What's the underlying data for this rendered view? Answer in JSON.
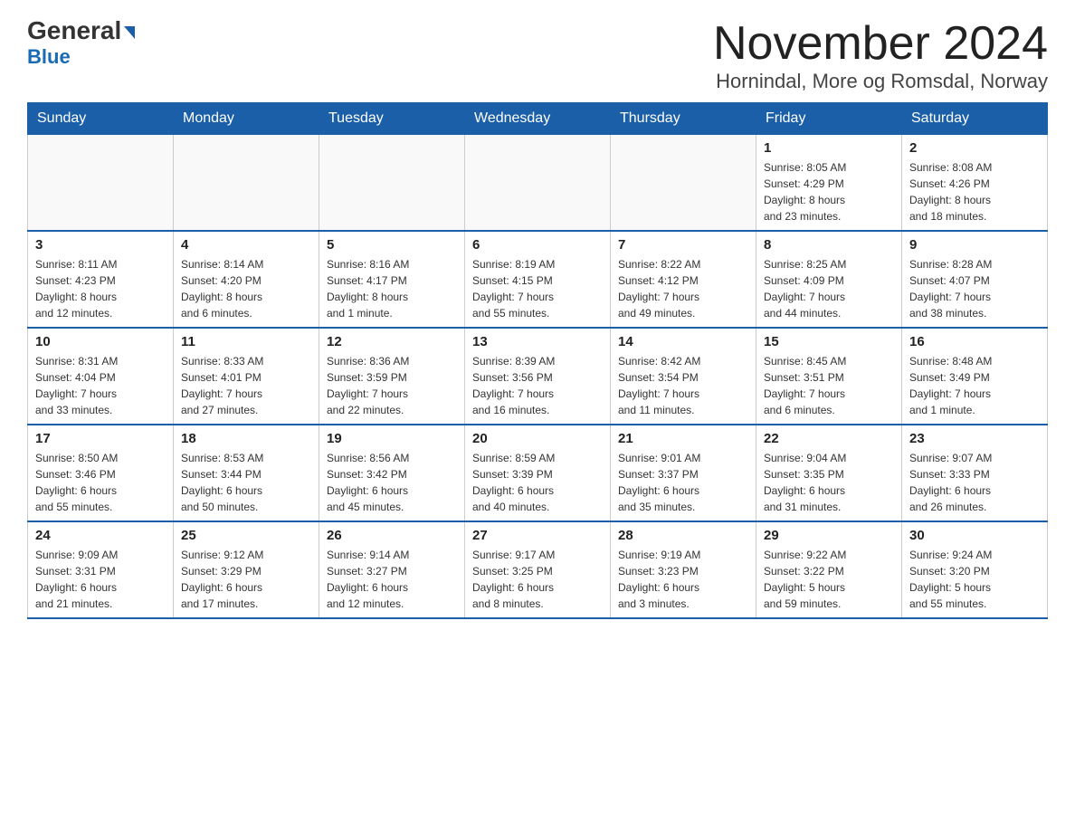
{
  "header": {
    "logo_general": "General",
    "logo_blue": "Blue",
    "title": "November 2024",
    "subtitle": "Hornindal, More og Romsdal, Norway"
  },
  "calendar": {
    "days_of_week": [
      "Sunday",
      "Monday",
      "Tuesday",
      "Wednesday",
      "Thursday",
      "Friday",
      "Saturday"
    ],
    "weeks": [
      [
        {
          "day": "",
          "info": ""
        },
        {
          "day": "",
          "info": ""
        },
        {
          "day": "",
          "info": ""
        },
        {
          "day": "",
          "info": ""
        },
        {
          "day": "",
          "info": ""
        },
        {
          "day": "1",
          "info": "Sunrise: 8:05 AM\nSunset: 4:29 PM\nDaylight: 8 hours\nand 23 minutes."
        },
        {
          "day": "2",
          "info": "Sunrise: 8:08 AM\nSunset: 4:26 PM\nDaylight: 8 hours\nand 18 minutes."
        }
      ],
      [
        {
          "day": "3",
          "info": "Sunrise: 8:11 AM\nSunset: 4:23 PM\nDaylight: 8 hours\nand 12 minutes."
        },
        {
          "day": "4",
          "info": "Sunrise: 8:14 AM\nSunset: 4:20 PM\nDaylight: 8 hours\nand 6 minutes."
        },
        {
          "day": "5",
          "info": "Sunrise: 8:16 AM\nSunset: 4:17 PM\nDaylight: 8 hours\nand 1 minute."
        },
        {
          "day": "6",
          "info": "Sunrise: 8:19 AM\nSunset: 4:15 PM\nDaylight: 7 hours\nand 55 minutes."
        },
        {
          "day": "7",
          "info": "Sunrise: 8:22 AM\nSunset: 4:12 PM\nDaylight: 7 hours\nand 49 minutes."
        },
        {
          "day": "8",
          "info": "Sunrise: 8:25 AM\nSunset: 4:09 PM\nDaylight: 7 hours\nand 44 minutes."
        },
        {
          "day": "9",
          "info": "Sunrise: 8:28 AM\nSunset: 4:07 PM\nDaylight: 7 hours\nand 38 minutes."
        }
      ],
      [
        {
          "day": "10",
          "info": "Sunrise: 8:31 AM\nSunset: 4:04 PM\nDaylight: 7 hours\nand 33 minutes."
        },
        {
          "day": "11",
          "info": "Sunrise: 8:33 AM\nSunset: 4:01 PM\nDaylight: 7 hours\nand 27 minutes."
        },
        {
          "day": "12",
          "info": "Sunrise: 8:36 AM\nSunset: 3:59 PM\nDaylight: 7 hours\nand 22 minutes."
        },
        {
          "day": "13",
          "info": "Sunrise: 8:39 AM\nSunset: 3:56 PM\nDaylight: 7 hours\nand 16 minutes."
        },
        {
          "day": "14",
          "info": "Sunrise: 8:42 AM\nSunset: 3:54 PM\nDaylight: 7 hours\nand 11 minutes."
        },
        {
          "day": "15",
          "info": "Sunrise: 8:45 AM\nSunset: 3:51 PM\nDaylight: 7 hours\nand 6 minutes."
        },
        {
          "day": "16",
          "info": "Sunrise: 8:48 AM\nSunset: 3:49 PM\nDaylight: 7 hours\nand 1 minute."
        }
      ],
      [
        {
          "day": "17",
          "info": "Sunrise: 8:50 AM\nSunset: 3:46 PM\nDaylight: 6 hours\nand 55 minutes."
        },
        {
          "day": "18",
          "info": "Sunrise: 8:53 AM\nSunset: 3:44 PM\nDaylight: 6 hours\nand 50 minutes."
        },
        {
          "day": "19",
          "info": "Sunrise: 8:56 AM\nSunset: 3:42 PM\nDaylight: 6 hours\nand 45 minutes."
        },
        {
          "day": "20",
          "info": "Sunrise: 8:59 AM\nSunset: 3:39 PM\nDaylight: 6 hours\nand 40 minutes."
        },
        {
          "day": "21",
          "info": "Sunrise: 9:01 AM\nSunset: 3:37 PM\nDaylight: 6 hours\nand 35 minutes."
        },
        {
          "day": "22",
          "info": "Sunrise: 9:04 AM\nSunset: 3:35 PM\nDaylight: 6 hours\nand 31 minutes."
        },
        {
          "day": "23",
          "info": "Sunrise: 9:07 AM\nSunset: 3:33 PM\nDaylight: 6 hours\nand 26 minutes."
        }
      ],
      [
        {
          "day": "24",
          "info": "Sunrise: 9:09 AM\nSunset: 3:31 PM\nDaylight: 6 hours\nand 21 minutes."
        },
        {
          "day": "25",
          "info": "Sunrise: 9:12 AM\nSunset: 3:29 PM\nDaylight: 6 hours\nand 17 minutes."
        },
        {
          "day": "26",
          "info": "Sunrise: 9:14 AM\nSunset: 3:27 PM\nDaylight: 6 hours\nand 12 minutes."
        },
        {
          "day": "27",
          "info": "Sunrise: 9:17 AM\nSunset: 3:25 PM\nDaylight: 6 hours\nand 8 minutes."
        },
        {
          "day": "28",
          "info": "Sunrise: 9:19 AM\nSunset: 3:23 PM\nDaylight: 6 hours\nand 3 minutes."
        },
        {
          "day": "29",
          "info": "Sunrise: 9:22 AM\nSunset: 3:22 PM\nDaylight: 5 hours\nand 59 minutes."
        },
        {
          "day": "30",
          "info": "Sunrise: 9:24 AM\nSunset: 3:20 PM\nDaylight: 5 hours\nand 55 minutes."
        }
      ]
    ]
  }
}
